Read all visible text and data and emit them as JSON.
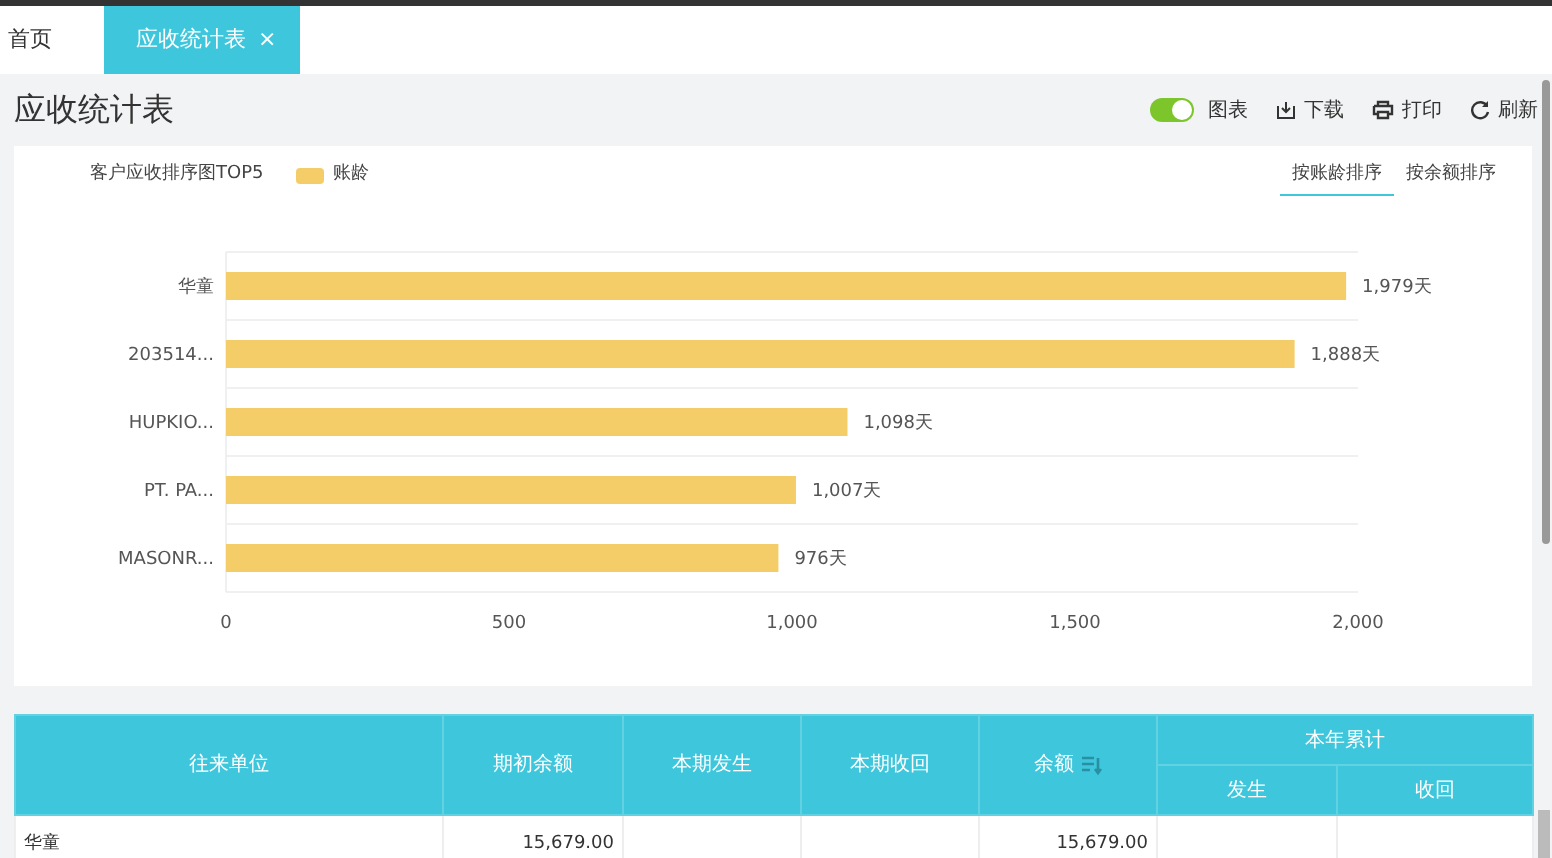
{
  "tabs": [
    {
      "label": "首页",
      "selected": false
    },
    {
      "label": "应收统计表",
      "selected": true,
      "close": "×"
    }
  ],
  "page_title": "应收统计表",
  "toolbar": {
    "chart_toggle": {
      "label": "图表",
      "on": true
    },
    "actions": [
      {
        "kind": "download",
        "label": "下载"
      },
      {
        "kind": "print",
        "label": "打印"
      },
      {
        "kind": "refresh",
        "label": "刷新"
      }
    ]
  },
  "chart_card": {
    "title": "客户应收排序图TOP5",
    "sort_tabs": [
      {
        "label": "按账龄排序",
        "selected": true
      },
      {
        "label": "按余额排序",
        "selected": false
      }
    ],
    "chart_data": {
      "type": "bar",
      "orientation": "horizontal",
      "categories": [
        "华童",
        "203514...",
        "HUPKIO...",
        "PT. PA...",
        "MASONR..."
      ],
      "series": [
        {
          "name": "账龄",
          "color": "#f4cd69",
          "values": [
            1979,
            1888,
            1098,
            1007,
            976
          ]
        }
      ],
      "value_labels": [
        "1,979天",
        "1,888天",
        "1,098天",
        "1,007天",
        "976天"
      ],
      "xlim": [
        0,
        2000
      ],
      "xticks": [
        {
          "value": 0,
          "label": "0"
        },
        {
          "value": 500,
          "label": "500"
        },
        {
          "value": 1000,
          "label": "1,000"
        },
        {
          "value": 1500,
          "label": "1,500"
        },
        {
          "value": 2000,
          "label": "2,000"
        }
      ]
    }
  },
  "table": {
    "columns": [
      {
        "label": "往来单位"
      },
      {
        "label": "期初余额"
      },
      {
        "label": "本期发生"
      },
      {
        "label": "本期收回"
      },
      {
        "label": "余额",
        "sortable": true
      },
      {
        "label": "本年累计",
        "children": [
          {
            "label": "发生"
          },
          {
            "label": "收回"
          }
        ]
      }
    ],
    "rows": [
      {
        "cells": [
          "华童",
          "15,679.00",
          null,
          null,
          "15,679.00",
          null,
          null
        ]
      }
    ]
  }
}
